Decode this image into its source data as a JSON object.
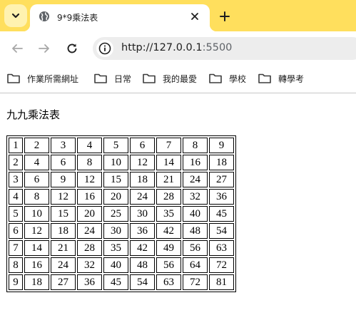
{
  "browser": {
    "tab": {
      "title": "9*9乘法表"
    },
    "address": {
      "host": "http://127.0.0.1",
      "port": ":5500"
    },
    "bookmarks": [
      {
        "label": "作業所需網址"
      },
      {
        "label": "日常"
      },
      {
        "label": "我的最愛"
      },
      {
        "label": "學校"
      },
      {
        "label": "轉學考"
      }
    ]
  },
  "page": {
    "heading": "九九乘法表",
    "table": [
      [
        "1",
        "2",
        "3",
        "4",
        "5",
        "6",
        "7",
        "8",
        "9"
      ],
      [
        "2",
        "4",
        "6",
        "8",
        "10",
        "12",
        "14",
        "16",
        "18"
      ],
      [
        "3",
        "6",
        "9",
        "12",
        "15",
        "18",
        "21",
        "24",
        "27"
      ],
      [
        "4",
        "8",
        "12",
        "16",
        "20",
        "24",
        "28",
        "32",
        "36"
      ],
      [
        "5",
        "10",
        "15",
        "20",
        "25",
        "30",
        "35",
        "40",
        "45"
      ],
      [
        "6",
        "12",
        "18",
        "24",
        "30",
        "36",
        "42",
        "48",
        "54"
      ],
      [
        "7",
        "14",
        "21",
        "28",
        "35",
        "42",
        "49",
        "56",
        "63"
      ],
      [
        "8",
        "16",
        "24",
        "32",
        "40",
        "48",
        "56",
        "64",
        "72"
      ],
      [
        "9",
        "18",
        "27",
        "36",
        "45",
        "54",
        "63",
        "72",
        "81"
      ]
    ]
  },
  "colors": {
    "tabstrip": "#ffdf5d",
    "omnibox": "#ededed"
  }
}
